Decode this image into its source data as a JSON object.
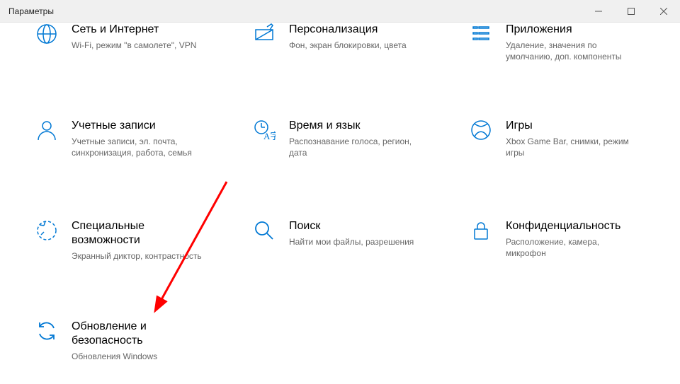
{
  "window": {
    "title": "Параметры"
  },
  "tiles": {
    "network": {
      "title": "Сеть и Интернет",
      "desc": "Wi-Fi, режим \"в самолете\", VPN"
    },
    "personal": {
      "title": "Персонализация",
      "desc": "Фон, экран блокировки, цвета"
    },
    "apps": {
      "title": "Приложения",
      "desc": "Удаление, значения по умолчанию, доп. компоненты"
    },
    "accounts": {
      "title": "Учетные записи",
      "desc": "Учетные записи, эл. почта, синхронизация, работа, семья"
    },
    "time": {
      "title": "Время и язык",
      "desc": "Распознавание голоса, регион, дата"
    },
    "games": {
      "title": "Игры",
      "desc": "Xbox Game Bar, снимки, режим игры"
    },
    "access": {
      "title": "Специальные возможности",
      "desc": "Экранный диктор, контрастность"
    },
    "search": {
      "title": "Поиск",
      "desc": "Найти мои файлы, разрешения"
    },
    "privacy": {
      "title": "Конфиденциальность",
      "desc": "Расположение, камера, микрофон"
    },
    "update": {
      "title": "Обновление и безопасность",
      "desc": "Обновления Windows"
    }
  },
  "accent": "#0078d4",
  "arrow_color": "#ff0000"
}
